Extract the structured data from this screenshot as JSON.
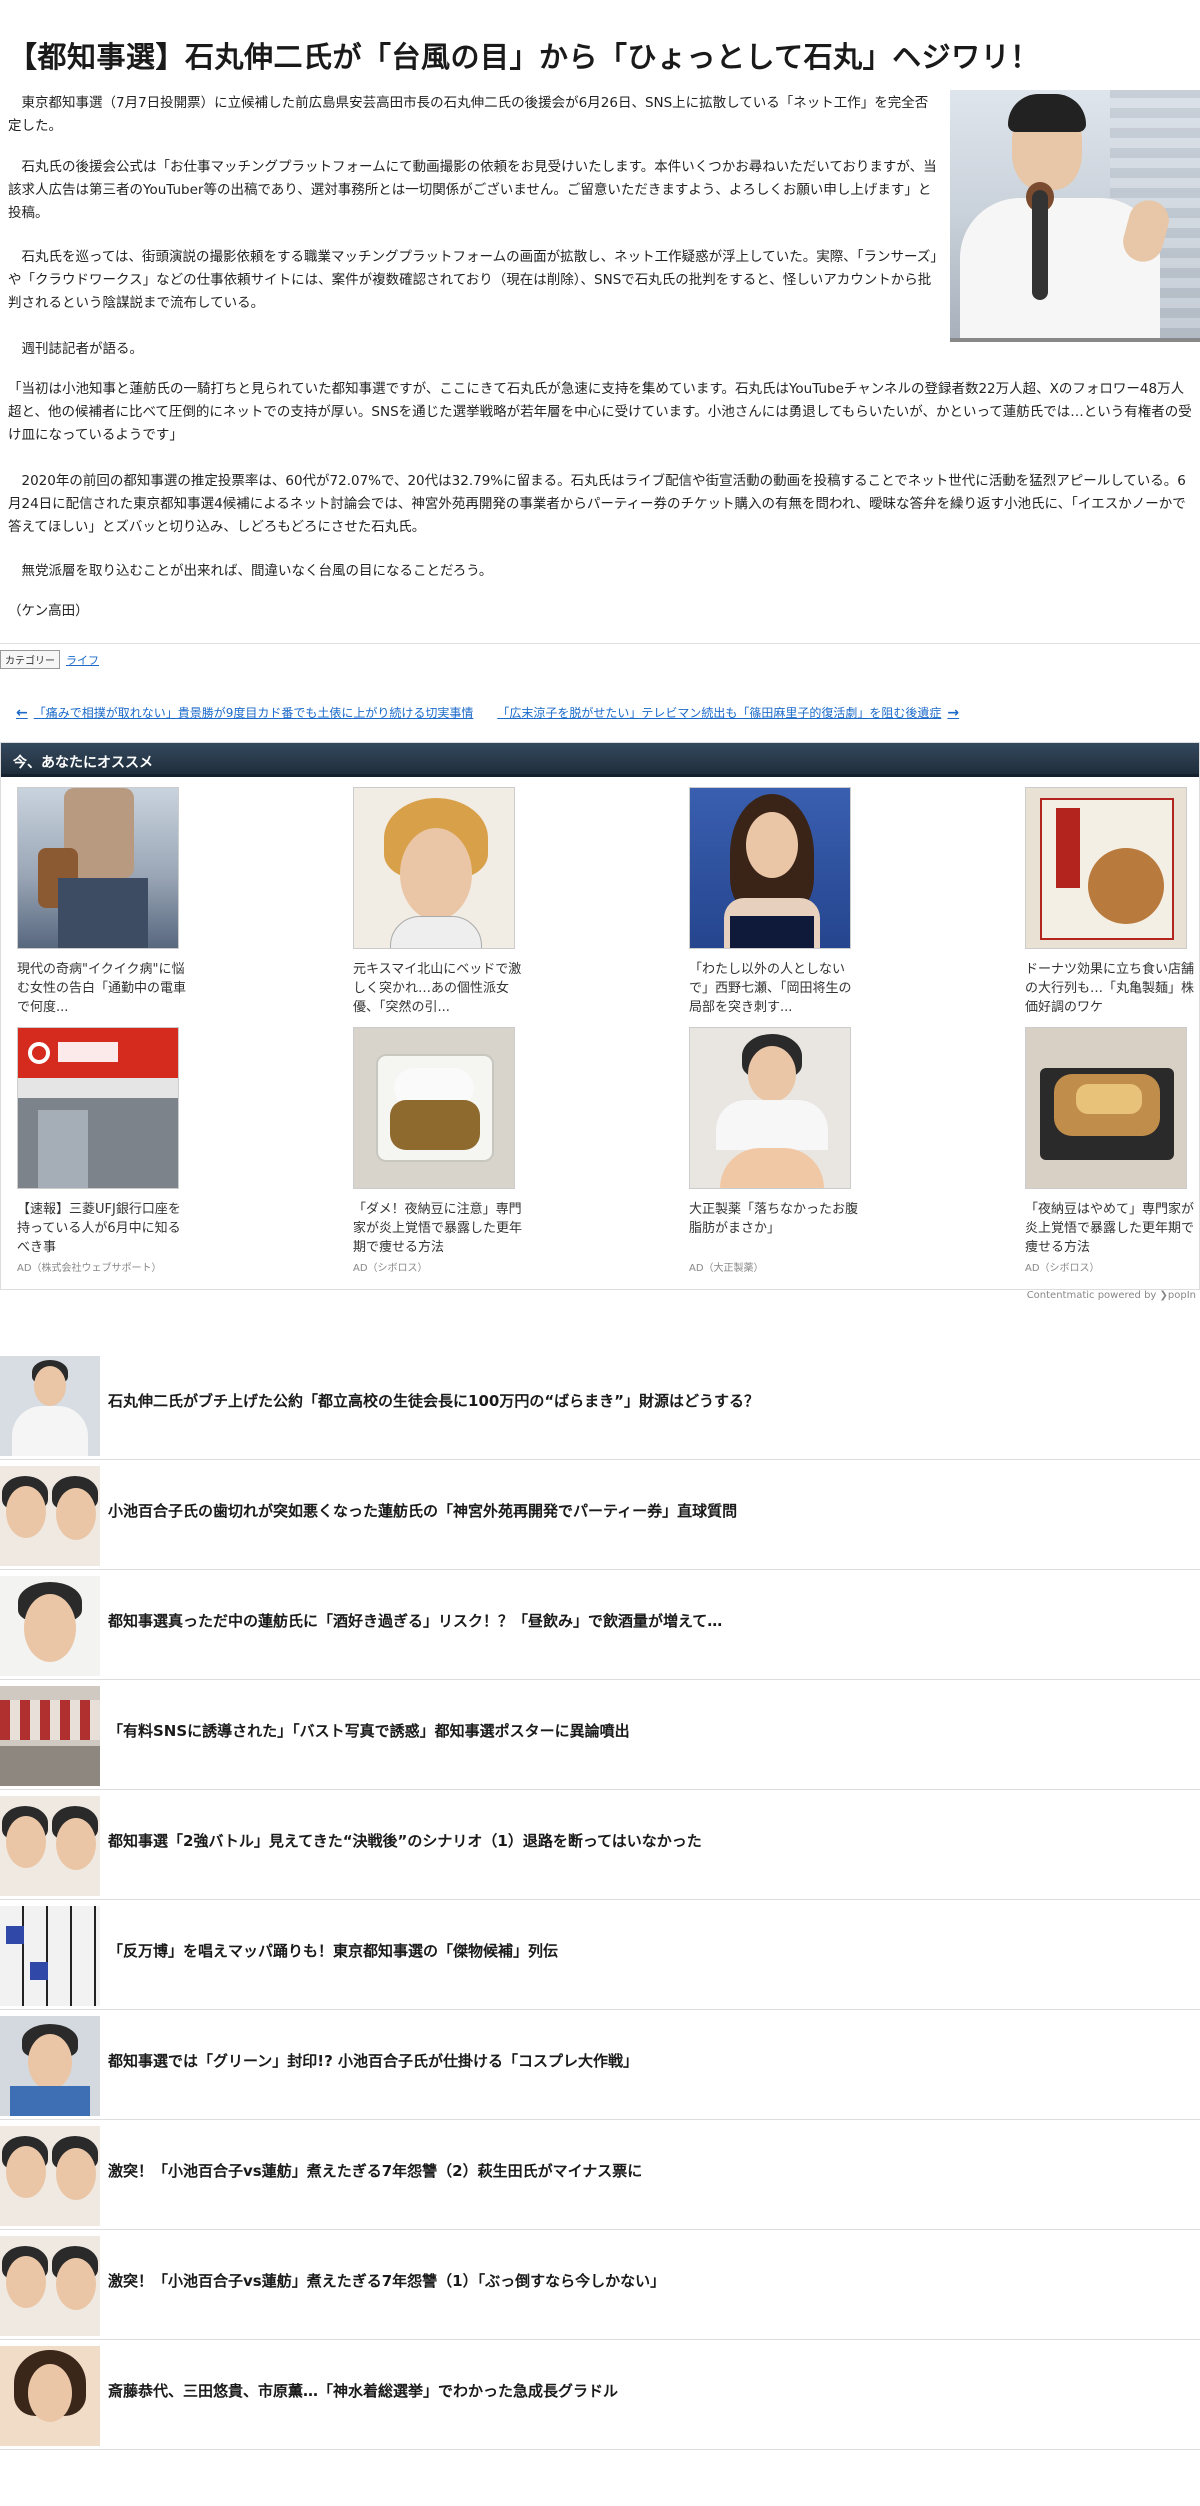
{
  "article": {
    "title": "【都知事選】石丸伸二氏が「台風の目」から「ひょっとして石丸」ヘジワリ！",
    "paragraphs": [
      "　東京都知事選（7月7日投開票）に立候補した前広島県安芸高田市長の石丸伸二氏の後援会が6月26日、SNS上に拡散している「ネット工作」を完全否定した。",
      "　石丸氏の後援会公式は「お仕事マッチングプラットフォームにて動画撮影の依頼をお見受けいたします。本件いくつかお尋ねいただいておりますが、当該求人広告は第三者のYouTuber等の出稿であり、選対事務所とは一切関係がございません。ご留意いただきますよう、よろしくお願い申し上げます」と投稿。",
      "　石丸氏を巡っては、街頭演説の撮影依頼をする職業マッチングプラットフォームの画面が拡散し、ネット工作疑惑が浮上していた。実際、「ランサーズ」や「クラウドワークス」などの仕事依頼サイトには、案件が複数確認されており（現在は削除）、SNSで石丸氏の批判をすると、怪しいアカウントから批判されるという陰謀説まで流布している。",
      "　週刊誌記者が語る。",
      "「当初は小池知事と蓮舫氏の一騎打ちと見られていた都知事選ですが、ここにきて石丸氏が急速に支持を集めています。石丸氏はYouTubeチャンネルの登録者数22万人超、Xのフォロワー48万人超と、他の候補者に比べて圧倒的にネットでの支持が厚い。SNSを通じた選挙戦略が若年層を中心に受けています。小池さんには勇退してもらいたいが、かといって蓮舫氏では…という有権者の受け皿になっているようです」",
      "　2020年の前回の都知事選の推定投票率は、60代が72.07%で、20代は32.79%に留まる。石丸氏はライブ配信や街宣活動の動画を投稿することでネット世代に活動を猛烈アピールしている。6月24日に配信された東京都知事選4候補によるネット討論会では、神宮外苑再開発の事業者からパーティー券のチケット購入の有無を問われ、曖昧な答弁を繰り返す小池氏に、「イエスかノーかで答えてほしい」とズバッと切り込み、しどろもどろにさせた石丸氏。",
      "　無党派層を取り込むことが出来れば、間違いなく台風の目になることだろう。",
      "（ケン高田）"
    ],
    "category_label": "カテゴリー",
    "category_value": "ライフ"
  },
  "nav": {
    "prev": "「痛みで相撲が取れない」貴景勝が9度目カド番でも土俵に上がり続ける切実事情",
    "next": "「広末涼子を脱がせたい」テレビマン続出も「篠田麻里子的復活劇」を阻む後遺症"
  },
  "reco": {
    "header": "今、あなたにオススメ",
    "items": [
      {
        "caption": "現代の奇病\"イクイク病\"に悩む女性の告白「通勤中の電車で何度...",
        "ad": ""
      },
      {
        "caption": "元キスマイ北山にベッドで激しく突かれ…あの個性派女優、「突然の引...",
        "ad": ""
      },
      {
        "caption": "「わたし以外の人としないで」西野七瀬、「岡田将生の局部を突き刺す...",
        "ad": ""
      },
      {
        "caption": "ドーナツ効果に立ち食い店舗の大行列も…「丸亀製麺」株価好調のワケ",
        "ad": ""
      },
      {
        "caption": "【速報】三菱UFJ銀行口座を持っている人が6月中に知るべき事",
        "ad": "AD（株式会社ウェブサポート）"
      },
      {
        "caption": "「ダメ！夜納豆に注意」専門家が炎上覚悟で暴露した更年期で痩せる方法",
        "ad": "AD（シボロス）"
      },
      {
        "caption": "大正製薬「落ちなかったお腹脂肪がまさか」",
        "ad": "AD（大正製薬）"
      },
      {
        "caption": "「夜納豆はやめて」専門家が炎上覚悟で暴露した更年期で痩せる方法",
        "ad": "AD（シボロス）"
      }
    ],
    "powered_by": "Contentmatic powered by ❯popIn"
  },
  "related": [
    "石丸伸二氏がブチ上げた公約「都立高校の生徒会長に100万円の“ばらまき”」財源はどうする？",
    "小池百合子氏の歯切れが突如悪くなった蓮舫氏の「神宮外苑再開発でパーティー券」直球質問",
    "都知事選真っただ中の蓮舫氏に「酒好き過ぎる」リスク！？「昼飲み」で飲酒量が増えて…",
    "「有料SNSに誘導された」「バスト写真で誘惑」都知事選ポスターに異論噴出",
    "都知事選「2強バトル」見えてきた“決戦後”のシナリオ（1）退路を断ってはいなかった",
    "「反万博」を唱えマッパ踊りも！東京都知事選の「傑物候補」列伝",
    "都知事選では「グリーン」封印!? 小池百合子氏が仕掛ける「コスプレ大作戦」",
    "激突！「小池百合子vs蓮舫」煮えたぎる7年怨讐（2）萩生田氏がマイナス票に",
    "激突！「小池百合子vs蓮舫」煮えたぎる7年怨讐（1）「ぶっ倒すなら今しかない」",
    "斎藤恭代、三田悠貴、市原薫…「神水着総選挙」でわかった急成長グラドル"
  ],
  "colors": {
    "link": "#1b6ac9",
    "reco_header_bg": "#2b3a49"
  }
}
